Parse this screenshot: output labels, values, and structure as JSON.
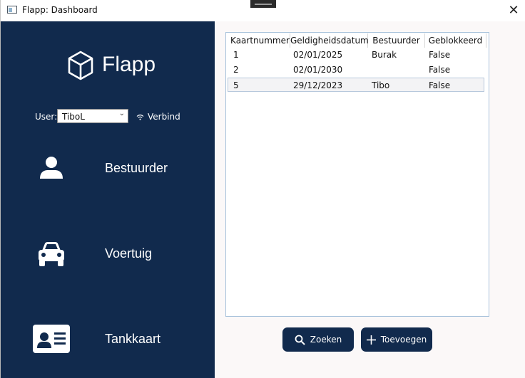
{
  "window": {
    "title": "Flapp: Dashboard",
    "close_glyph": "✕"
  },
  "sidebar": {
    "logo_text": "Flapp",
    "user_label": "User:",
    "user_value": "TiboL",
    "connect_label": "Verbind",
    "items": [
      {
        "label": "Bestuurder",
        "icon": "person-icon"
      },
      {
        "label": "Voertuig",
        "icon": "car-icon"
      },
      {
        "label": "Tankkaart",
        "icon": "id-card-icon"
      }
    ]
  },
  "grid": {
    "columns": [
      "Kaartnummer",
      "Geldigheidsdatum",
      "Bestuurder",
      "Geblokkeerd"
    ],
    "rows": [
      {
        "kaartnummer": "1",
        "datum": "02/01/2025",
        "bestuurder": "Burak",
        "geblokkeerd": "False"
      },
      {
        "kaartnummer": "2",
        "datum": "02/01/2030",
        "bestuurder": "",
        "geblokkeerd": "False"
      },
      {
        "kaartnummer": "5",
        "datum": "29/12/2023",
        "bestuurder": "Tibo",
        "geblokkeerd": "False"
      }
    ]
  },
  "actions": {
    "search_label": "Zoeken",
    "add_label": "Toevoegen"
  },
  "colors": {
    "sidebar": "#112a4d",
    "button": "#112a4d"
  }
}
